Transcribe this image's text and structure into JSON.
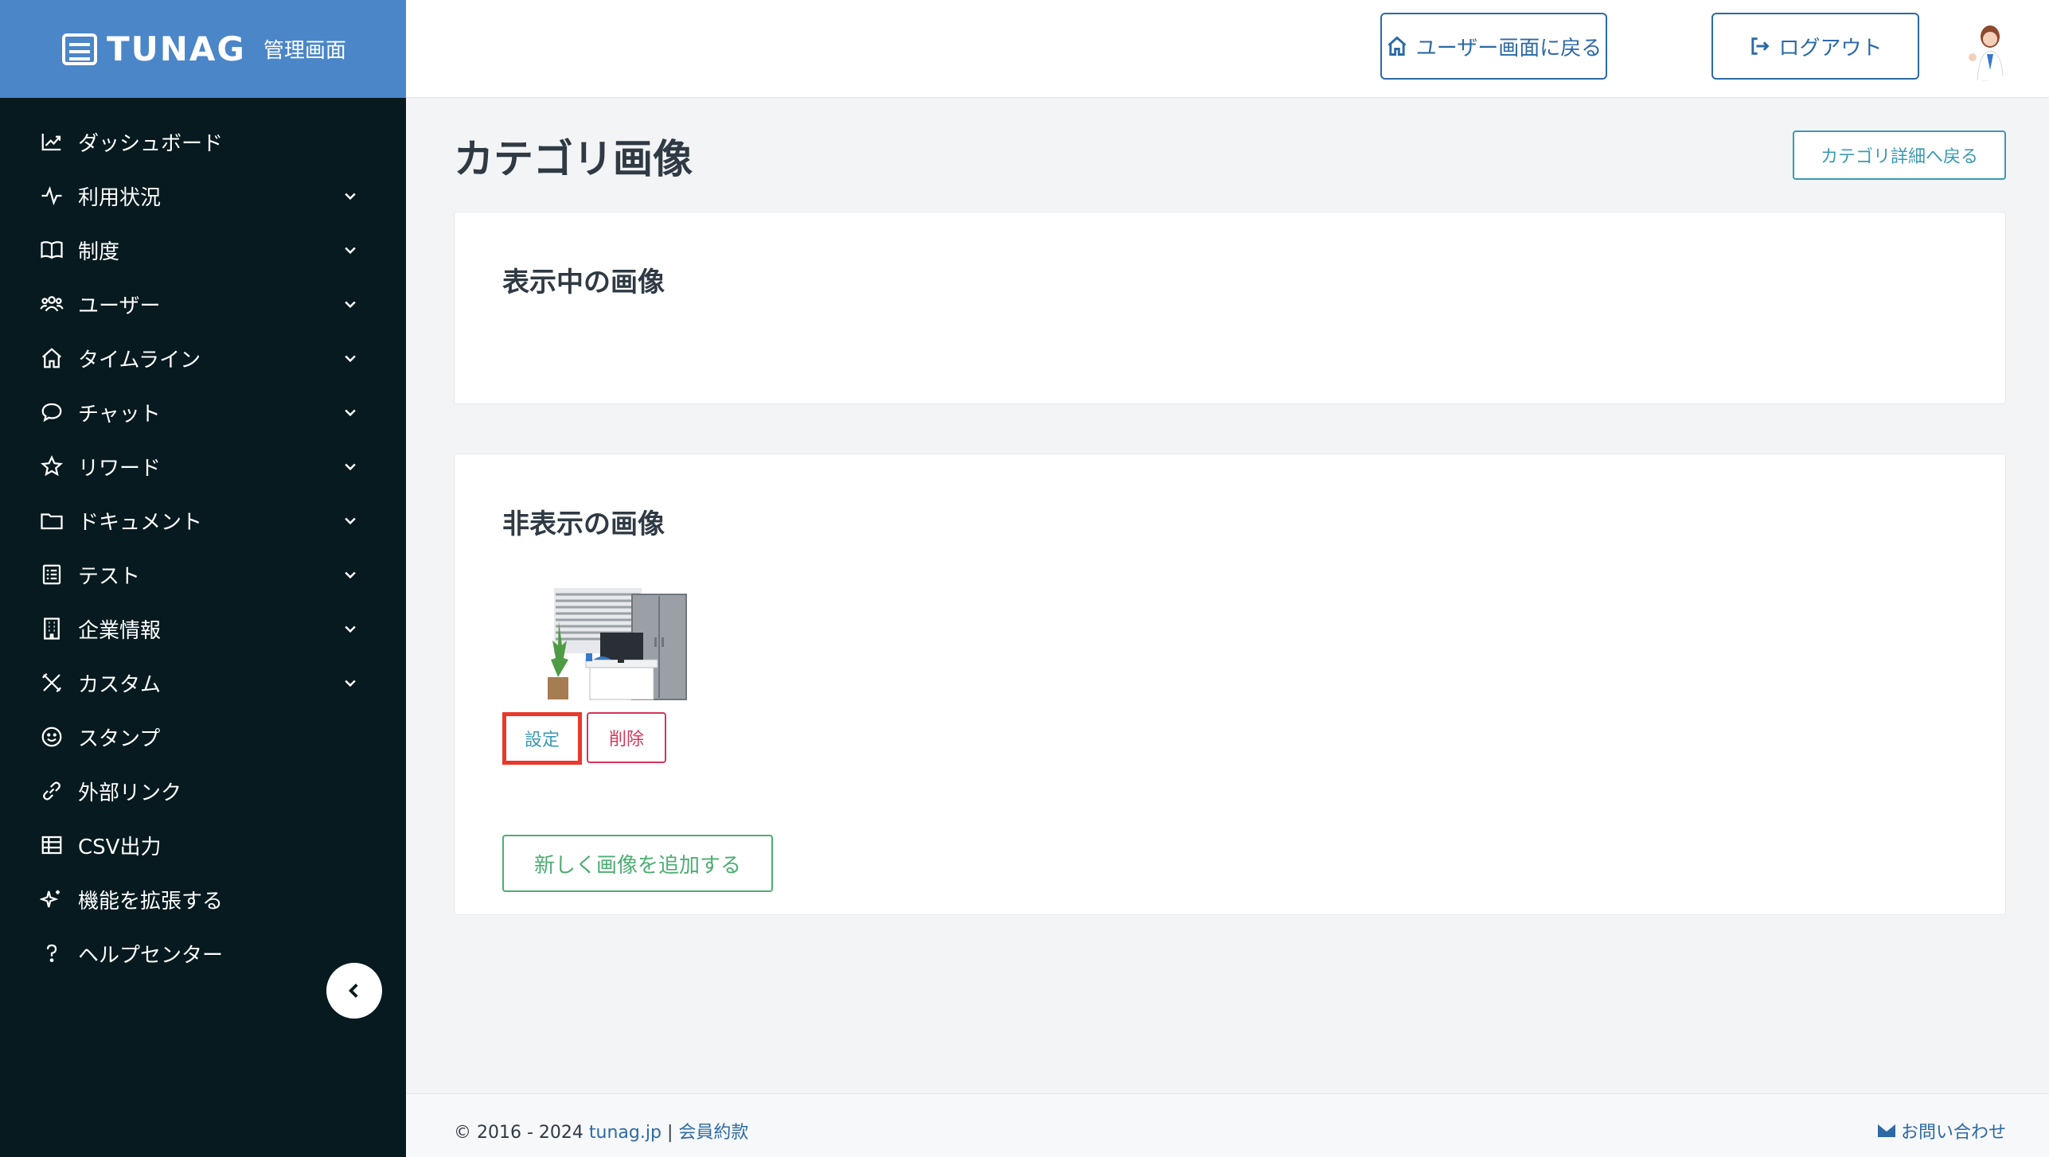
{
  "brand": {
    "name": "TUNAG",
    "sub": "管理画面",
    "color": "#4a86c8"
  },
  "sidebar": {
    "items": [
      {
        "label": "ダッシュボード",
        "icon": "chart-icon",
        "expandable": false
      },
      {
        "label": "利用状況",
        "icon": "activity-icon",
        "expandable": true
      },
      {
        "label": "制度",
        "icon": "book-icon",
        "expandable": true
      },
      {
        "label": "ユーザー",
        "icon": "users-icon",
        "expandable": true
      },
      {
        "label": "タイムライン",
        "icon": "home-icon",
        "expandable": true
      },
      {
        "label": "チャット",
        "icon": "chat-icon",
        "expandable": true
      },
      {
        "label": "リワード",
        "icon": "star-icon",
        "expandable": true
      },
      {
        "label": "ドキュメント",
        "icon": "folder-icon",
        "expandable": true
      },
      {
        "label": "テスト",
        "icon": "checklist-icon",
        "expandable": true
      },
      {
        "label": "企業情報",
        "icon": "building-icon",
        "expandable": true
      },
      {
        "label": "カスタム",
        "icon": "tools-icon",
        "expandable": true
      },
      {
        "label": "スタンプ",
        "icon": "smile-icon",
        "expandable": false
      },
      {
        "label": "外部リンク",
        "icon": "link-icon",
        "expandable": false
      },
      {
        "label": "CSV出力",
        "icon": "table-icon",
        "expandable": false
      },
      {
        "label": "機能を拡張する",
        "icon": "sparkle-icon",
        "expandable": false
      },
      {
        "label": "ヘルプセンター",
        "icon": "help-icon",
        "expandable": false
      }
    ]
  },
  "header": {
    "user_screen_label": "ユーザー画面に戻る",
    "logout_label": "ログアウト"
  },
  "main": {
    "title": "カテゴリ画像",
    "back_label": "カテゴリ詳細へ戻る",
    "visible_section_title": "表示中の画像",
    "hidden_section_title": "非表示の画像",
    "set_label": "設定",
    "delete_label": "削除",
    "add_label": "新しく画像を追加する"
  },
  "footer": {
    "copyright": "© 2016 - 2024",
    "site_link": "tunag.jp",
    "separator": "|",
    "terms_link": "会員約款",
    "contact_label": "お問い合わせ"
  },
  "colors": {
    "sidebar_bg": "#061a1f",
    "primary": "#2c6aa5",
    "teal": "#3a9ab3",
    "danger": "#d4365a",
    "success": "#4cae72",
    "highlight": "#e8392b"
  }
}
